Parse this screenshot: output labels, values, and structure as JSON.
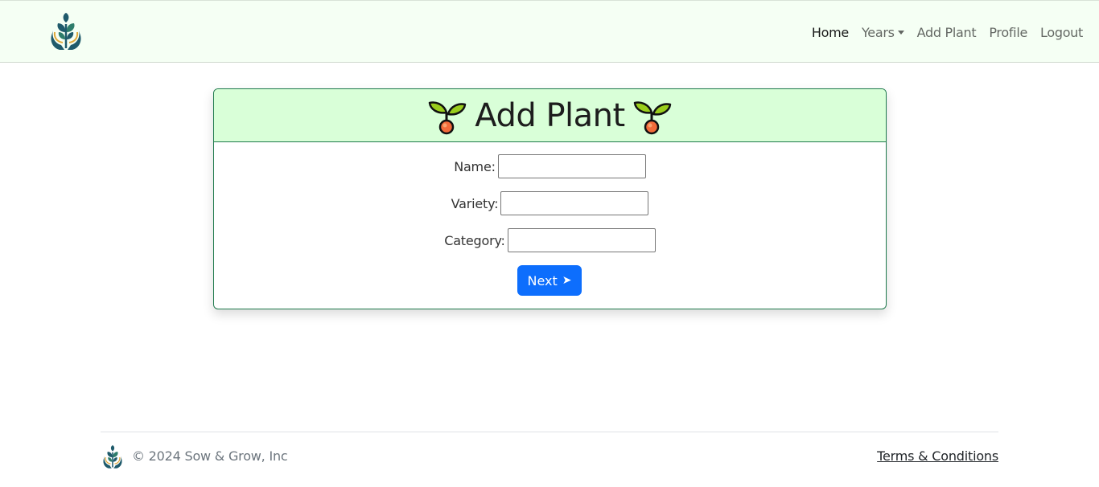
{
  "navbar": {
    "logo_icon": "hands-holding-plant-logo",
    "links": {
      "home": "Home",
      "years": "Years",
      "add_plant": "Add Plant",
      "profile": "Profile",
      "logout": "Logout"
    }
  },
  "card": {
    "title": "Add Plant",
    "title_icon": "seedling-icon",
    "fields": {
      "name": {
        "label": "Name:",
        "value": ""
      },
      "variety": {
        "label": "Variety:",
        "value": ""
      },
      "category": {
        "label": "Category:",
        "value": ""
      }
    },
    "next_button": {
      "label": "Next",
      "icon": "➤"
    }
  },
  "footer": {
    "copyright": "© 2024 Sow & Grow, Inc",
    "terms_link": "Terms & Conditions"
  },
  "colors": {
    "navbar_bg": "#f5fff4",
    "card_header_bg": "#d9ffd8",
    "card_border": "#1e7a4c",
    "primary_button": "#0d6efd",
    "logo_teal": "#1f5a6b",
    "logo_gold": "#e0a93a"
  }
}
